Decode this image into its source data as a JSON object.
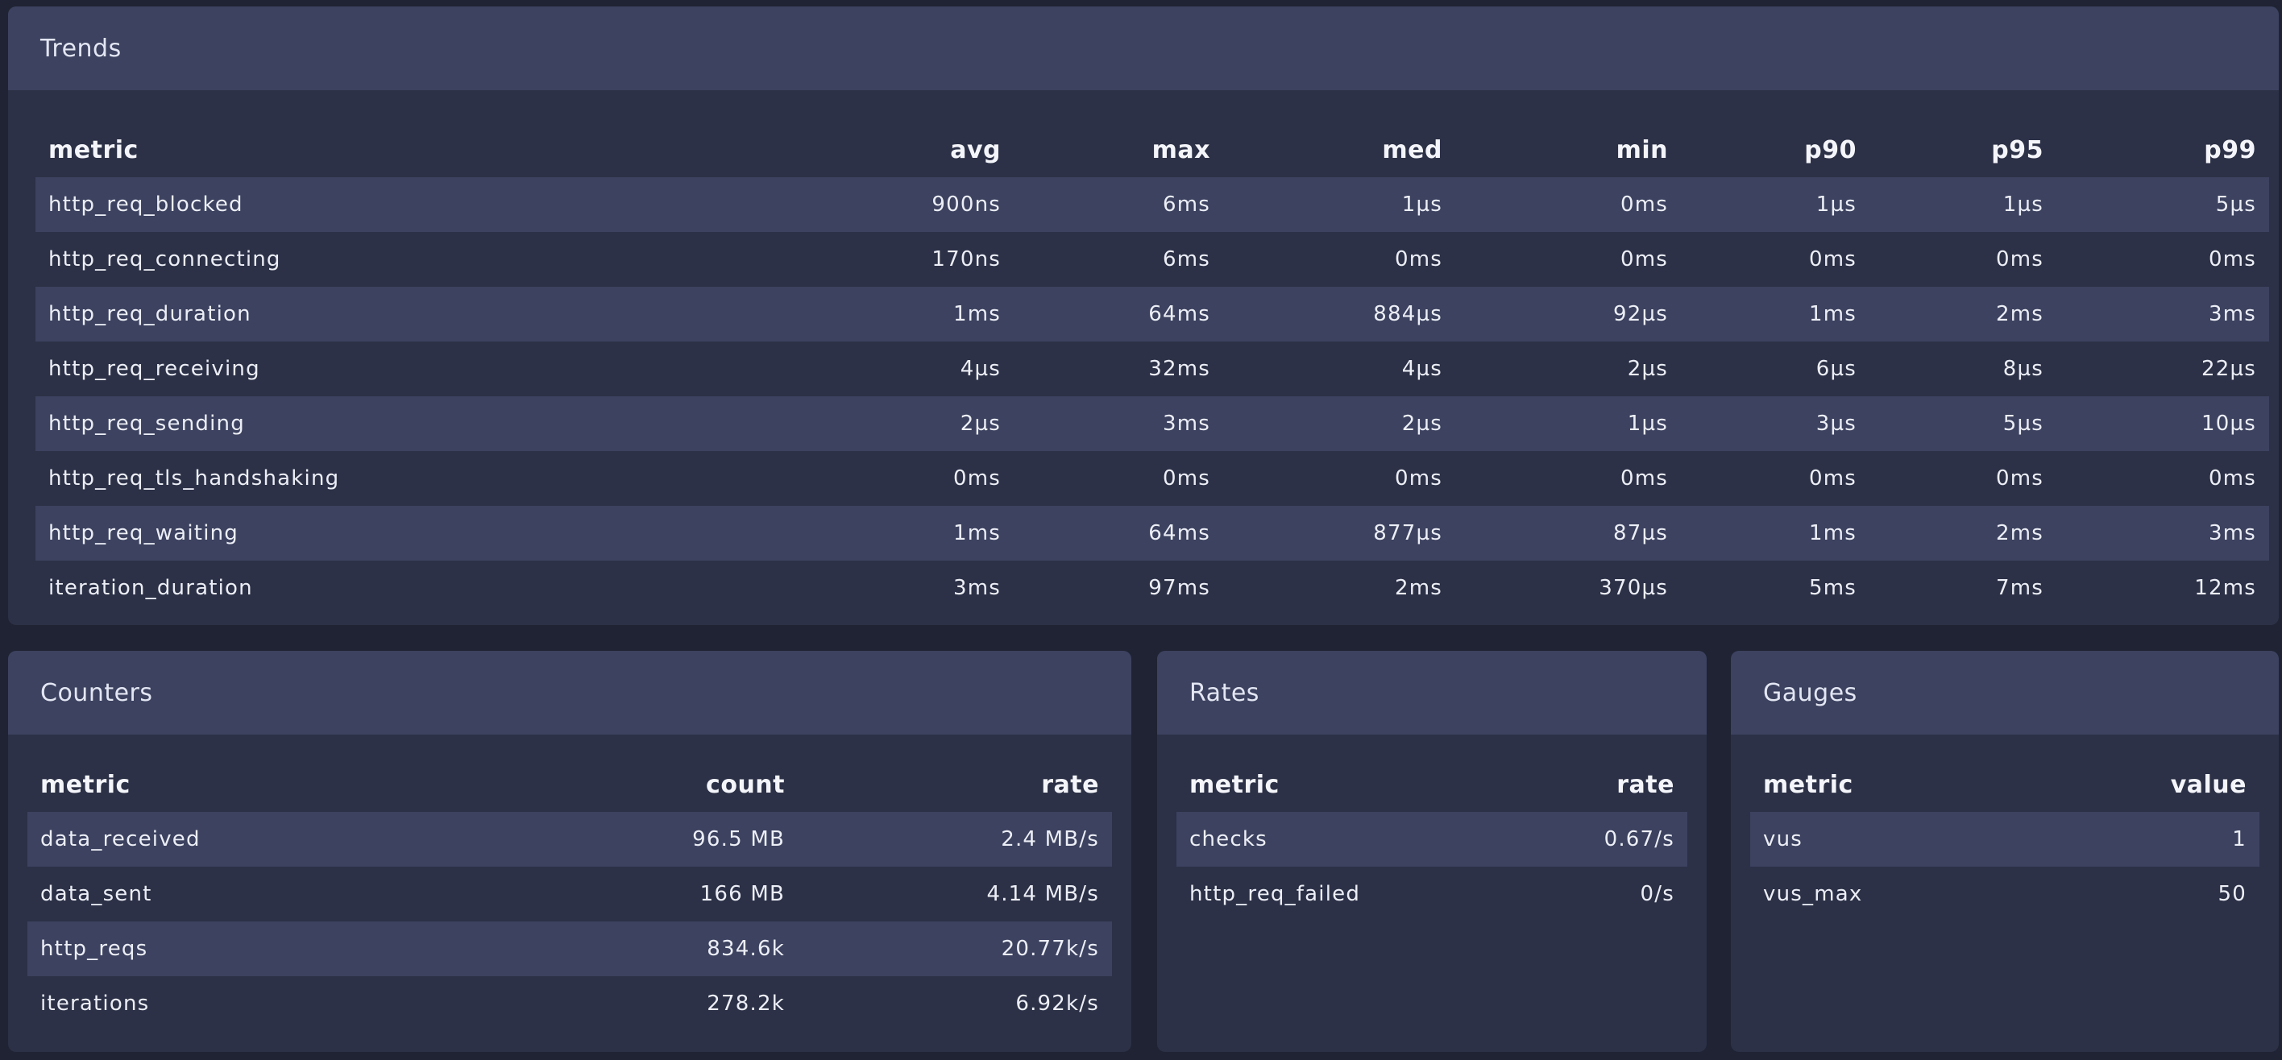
{
  "trends": {
    "title": "Trends",
    "columns": [
      "metric",
      "avg",
      "max",
      "med",
      "min",
      "p90",
      "p95",
      "p99"
    ],
    "rows": [
      [
        "http_req_blocked",
        "900ns",
        "6ms",
        "1µs",
        "0ms",
        "1µs",
        "1µs",
        "5µs"
      ],
      [
        "http_req_connecting",
        "170ns",
        "6ms",
        "0ms",
        "0ms",
        "0ms",
        "0ms",
        "0ms"
      ],
      [
        "http_req_duration",
        "1ms",
        "64ms",
        "884µs",
        "92µs",
        "1ms",
        "2ms",
        "3ms"
      ],
      [
        "http_req_receiving",
        "4µs",
        "32ms",
        "4µs",
        "2µs",
        "6µs",
        "8µs",
        "22µs"
      ],
      [
        "http_req_sending",
        "2µs",
        "3ms",
        "2µs",
        "1µs",
        "3µs",
        "5µs",
        "10µs"
      ],
      [
        "http_req_tls_handshaking",
        "0ms",
        "0ms",
        "0ms",
        "0ms",
        "0ms",
        "0ms",
        "0ms"
      ],
      [
        "http_req_waiting",
        "1ms",
        "64ms",
        "877µs",
        "87µs",
        "1ms",
        "2ms",
        "3ms"
      ],
      [
        "iteration_duration",
        "3ms",
        "97ms",
        "2ms",
        "370µs",
        "5ms",
        "7ms",
        "12ms"
      ]
    ]
  },
  "counters": {
    "title": "Counters",
    "columns": [
      "metric",
      "count",
      "rate"
    ],
    "rows": [
      [
        "data_received",
        "96.5 MB",
        "2.4 MB/s"
      ],
      [
        "data_sent",
        "166 MB",
        "4.14 MB/s"
      ],
      [
        "http_reqs",
        "834.6k",
        "20.77k/s"
      ],
      [
        "iterations",
        "278.2k",
        "6.92k/s"
      ]
    ]
  },
  "rates": {
    "title": "Rates",
    "columns": [
      "metric",
      "rate"
    ],
    "rows": [
      [
        "checks",
        "0.67/s"
      ],
      [
        "http_req_failed",
        "0/s"
      ]
    ]
  },
  "gauges": {
    "title": "Gauges",
    "columns": [
      "metric",
      "value"
    ],
    "rows": [
      [
        "vus",
        "1"
      ],
      [
        "vus_max",
        "50"
      ]
    ]
  },
  "colors": {
    "page_background": "#1f2333",
    "panel_background": "#2c3147",
    "panel_header": "#3c425f",
    "row_stripe": "#3c425f"
  }
}
